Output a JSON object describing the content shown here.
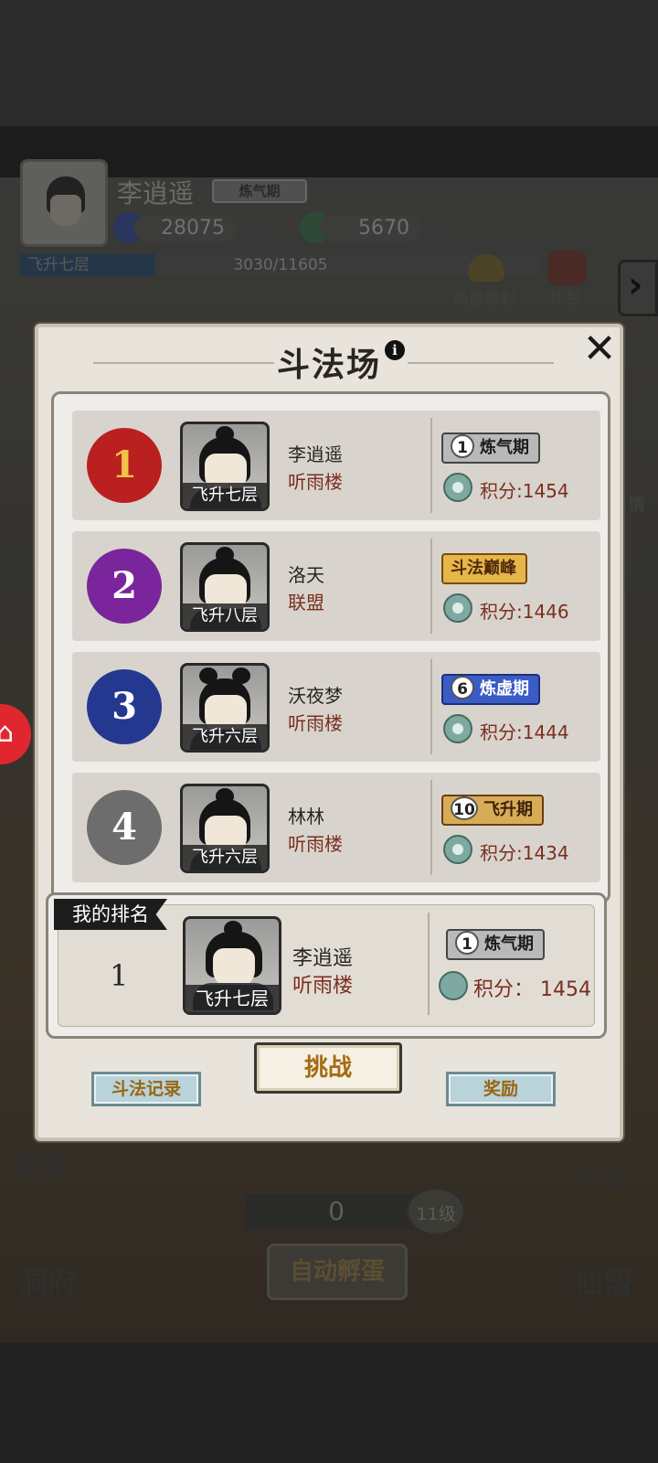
{
  "player": {
    "name": "李逍遥",
    "realm": "炼气期",
    "gems": "28075",
    "jade": "5670",
    "plus": "+",
    "layer": "飞升七层",
    "xp": "3030/11605",
    "xp_fraction": 0.26
  },
  "side_buttons": {
    "newbie_gift": "新服福利",
    "gift_pack": "礼包",
    "arrow": "›",
    "chat_short": "情"
  },
  "home_icon": "home-icon",
  "bg_labels": {
    "secret_realm": "秘境",
    "cave": "洞府",
    "duel": "斗法",
    "alliance": "仙盟"
  },
  "egg": {
    "count": "0",
    "level": "11级",
    "auto_hatch": "自动孵蛋"
  },
  "dialog": {
    "title": "斗法场",
    "info": "i",
    "close": "✕"
  },
  "rankings": [
    {
      "rank": "1",
      "name": "李逍遥",
      "guild": "听雨楼",
      "layer": "飞升七层",
      "realm_num": "1",
      "realm": "炼气期",
      "realm_style": "grey",
      "score": "积分:1454",
      "badge_color": "#b9201f",
      "badge_text": "#f1c24a"
    },
    {
      "rank": "2",
      "name": "洛天",
      "guild": "联盟",
      "layer": "飞升八层",
      "realm_num": "",
      "realm": "斗法巅峰",
      "realm_style": "gold",
      "score": "积分:1446",
      "badge_color": "#7a259b",
      "badge_text": "#ffffff"
    },
    {
      "rank": "3",
      "name": "沃夜梦",
      "guild": "听雨楼",
      "layer": "飞升六层",
      "realm_num": "6",
      "realm": "炼虚期",
      "realm_style": "blue",
      "score": "积分:1444",
      "badge_color": "#24388f",
      "badge_text": "#ffffff"
    },
    {
      "rank": "4",
      "name": "林林",
      "guild": "听雨楼",
      "layer": "飞升六层",
      "realm_num": "10",
      "realm": "飞升期",
      "realm_style": "bronze",
      "score": "积分:1434",
      "badge_color": "#6d6d6d",
      "badge_text": "#ffffff"
    }
  ],
  "my_rank": {
    "label": "我的排名",
    "rank": "1",
    "name": "李逍遥",
    "guild": "听雨楼",
    "layer": "飞升七层",
    "realm_num": "1",
    "realm": "炼气期",
    "score": "积分：  1454"
  },
  "buttons": {
    "records": "斗法记录",
    "challenge": "挑战",
    "rewards": "奖励"
  }
}
